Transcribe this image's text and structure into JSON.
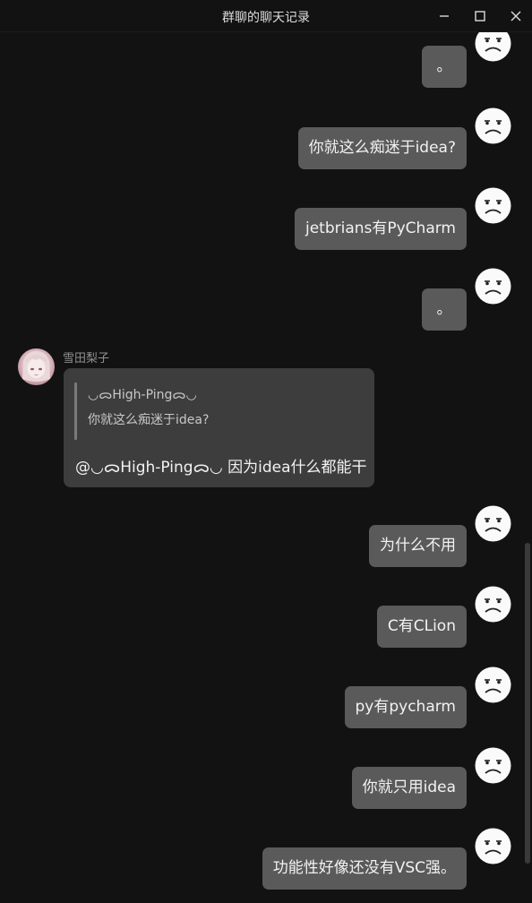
{
  "window": {
    "title": "群聊的聊天记录",
    "controls": [
      "minimize-icon",
      "maximize-icon",
      "close-icon"
    ]
  },
  "colors": {
    "background": "#121212",
    "outgoing_bubble": "#5a5a5a",
    "incoming_bubble": "#3d3d3d",
    "text": "#f2f2f2"
  },
  "messages_out_top": [
    {
      "text": "。"
    },
    {
      "text": "你就这么痴迷于idea?"
    },
    {
      "text": "jetbrians有PyCharm"
    },
    {
      "text": "。"
    }
  ],
  "incoming": {
    "sender": "雪田梨子",
    "quote_name": "◡ᯅHigh-Pingᯅ◡",
    "quote_text": "你就这么痴迷于idea?",
    "text": "@◡ᯅHigh-Pingᯅ◡ 因为idea什么都能干"
  },
  "messages_out_bottom": [
    {
      "text": "为什么不用"
    },
    {
      "text": "C有CLion"
    },
    {
      "text": "py有pycharm"
    },
    {
      "text": "你就只用idea"
    },
    {
      "text": "功能性好像还没有VSC强。"
    }
  ],
  "icons": {
    "self_avatar": "frowning-face-icon",
    "other_avatar": "anime-girl-avatar"
  }
}
